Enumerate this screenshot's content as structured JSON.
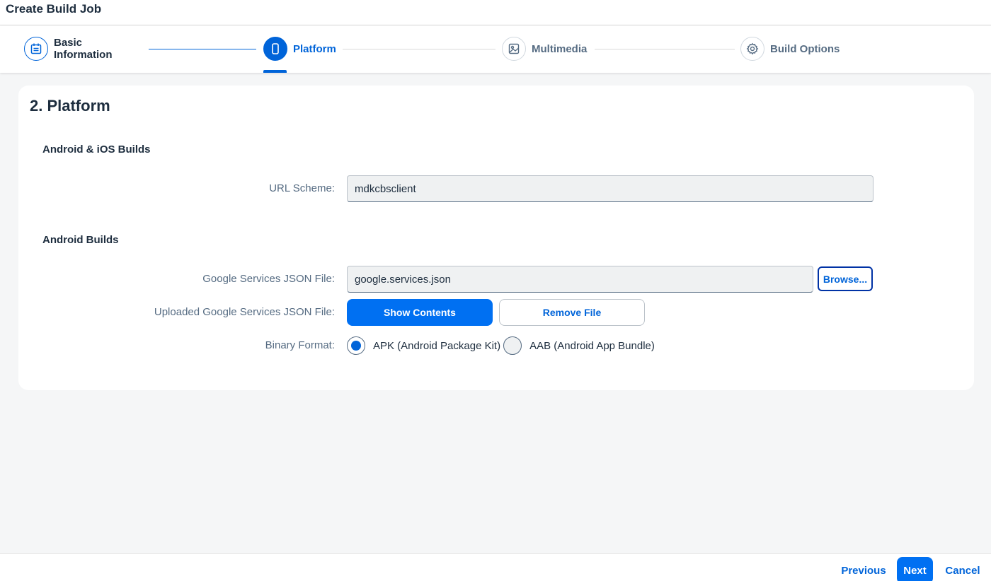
{
  "window": {
    "title": "Create Build Job"
  },
  "wizard": {
    "steps": [
      {
        "line1": "Basic",
        "line2": "Information",
        "state": "done",
        "icon": "calendar-icon"
      },
      {
        "label": "Platform",
        "state": "active",
        "icon": "mobile-device-icon"
      },
      {
        "label": "Multimedia",
        "state": "pending",
        "icon": "image-icon"
      },
      {
        "label": "Build Options",
        "state": "pending",
        "icon": "gear-icon"
      }
    ]
  },
  "main": {
    "heading": "2. Platform",
    "section_all": {
      "title": "Android & iOS Builds",
      "url_scheme_label": "URL Scheme:",
      "url_scheme_value": "mdkcbsclient"
    },
    "section_android": {
      "title": "Android Builds",
      "google_json_label": "Google Services JSON File:",
      "google_json_value": "google.services.json",
      "browse_label": "Browse...",
      "uploaded_label": "Uploaded Google Services JSON File:",
      "show_contents_label": "Show Contents",
      "remove_file_label": "Remove File",
      "binary_format_label": "Binary Format:",
      "binary_options": [
        {
          "label": "APK (Android Package Kit)",
          "selected": true
        },
        {
          "label": "AAB (Android App Bundle)",
          "selected": false
        }
      ]
    }
  },
  "footer": {
    "previous_label": "Previous",
    "next_label": "Next",
    "cancel_label": "Cancel"
  },
  "colors": {
    "accent": "#0070f2",
    "text": "#1d2d3e",
    "label": "#556b82"
  }
}
